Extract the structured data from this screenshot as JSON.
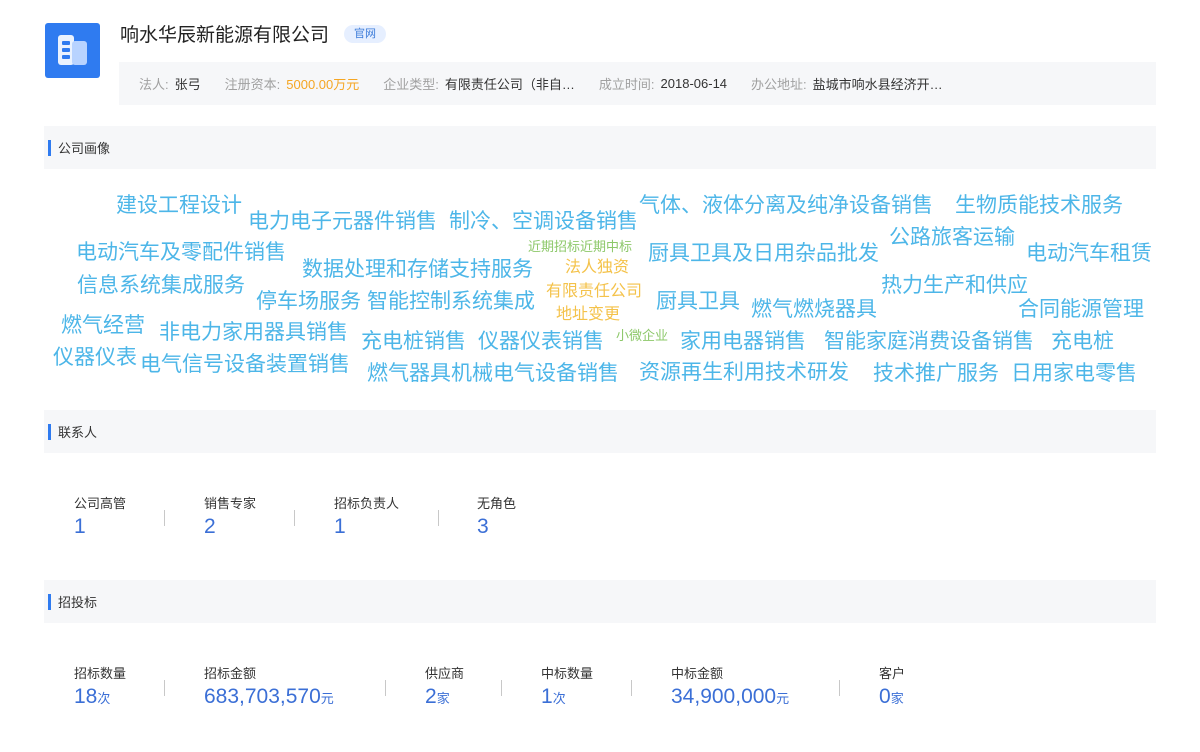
{
  "header": {
    "company_name": "响水华辰新能源有限公司",
    "site_badge": "官网",
    "info": {
      "legal_label": "法人:",
      "legal_value": "张弓",
      "capital_label": "注册资本:",
      "capital_value": "5000.00万元",
      "type_label": "企业类型:",
      "type_value": "有限责任公司（非自…",
      "founded_label": "成立时间:",
      "founded_value": "2018-06-14",
      "address_label": "办公地址:",
      "address_value": "盐城市响水县经济开…"
    }
  },
  "profile": {
    "title": "公司画像",
    "tags": [
      "建设工程设计",
      "电力电子元器件销售",
      "制冷、空调设备销售",
      "气体、液体分离及纯净设备销售",
      "生物质能技术服务",
      "电动汽车及零配件销售",
      "近期招标近期中标",
      "厨具卫具及日用杂品批发",
      "公路旅客运输",
      "电动汽车租赁",
      "信息系统集成服务",
      "数据处理和存储支持服务",
      "法人独资",
      "热力生产和供应",
      "停车场服务",
      "智能控制系统集成",
      "有限责任公司",
      "厨具卫具",
      "燃气燃烧器具",
      "合同能源管理",
      "燃气经营",
      "地址变更",
      "非电力家用器具销售",
      "充电桩销售",
      "仪器仪表销售",
      "小微企业",
      "家用电器销售",
      "智能家庭消费设备销售",
      "充电桩",
      "仪器仪表",
      "电气信号设备装置销售",
      "燃气器具机械电气设备销售",
      "资源再生利用技术研发",
      "技术推广服务",
      "日用家电零售"
    ]
  },
  "contacts": {
    "title": "联系人",
    "items": [
      {
        "label": "公司高管",
        "value": "1"
      },
      {
        "label": "销售专家",
        "value": "2"
      },
      {
        "label": "招标负责人",
        "value": "1"
      },
      {
        "label": "无角色",
        "value": "3"
      }
    ]
  },
  "bidding": {
    "title": "招投标",
    "items": [
      {
        "label": "招标数量",
        "value": "18",
        "unit": "次"
      },
      {
        "label": "招标金额",
        "value": "683,703,570",
        "unit": "元"
      },
      {
        "label": "供应商",
        "value": "2",
        "unit": "家"
      },
      {
        "label": "中标数量",
        "value": "1",
        "unit": "次"
      },
      {
        "label": "中标金额",
        "value": "34,900,000",
        "unit": "元"
      },
      {
        "label": "客户",
        "value": "0",
        "unit": "家"
      }
    ]
  },
  "colors": {
    "accent": "#2f7bf0",
    "stat_value": "#3b6fd6",
    "capital": "#f5a623",
    "cloud_blue": "#4db6e8",
    "cloud_yellow": "#f4c24a",
    "cloud_green": "#8dc86a"
  }
}
